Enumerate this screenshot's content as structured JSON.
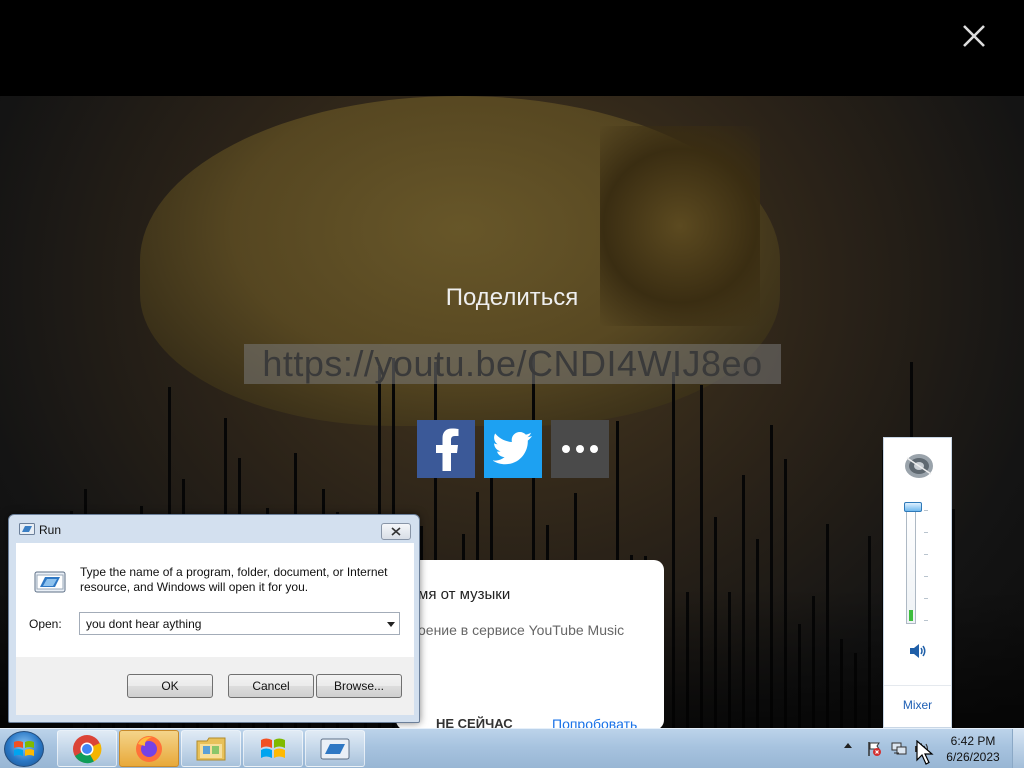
{
  "video": {
    "share_title": "Поделиться",
    "share_url": "https://youtu.be/CNDI4WIJ8eo",
    "share_buttons": [
      {
        "name": "facebook",
        "icon": "facebook-icon",
        "color": "#3b5998"
      },
      {
        "name": "twitter",
        "icon": "twitter-icon",
        "color": "#1da1f2"
      },
      {
        "name": "more",
        "icon": "more-dots-icon",
        "color": "#4a4a4a"
      }
    ]
  },
  "promo": {
    "title": "мя от музыки",
    "subtitle": "оение в сервисе YouTube Music",
    "later": "НЕ СЕЙЧАС",
    "try": "Попробовать"
  },
  "volume": {
    "level": 0.1,
    "mixer_label": "Mixer"
  },
  "run_dialog": {
    "title": "Run",
    "description": "Type the name of a program, folder, document, or Internet resource, and Windows will open it for you.",
    "open_label": "Open:",
    "open_value": "you dont hear aything",
    "ok_label": "OK",
    "cancel_label": "Cancel",
    "browse_label": "Browse..."
  },
  "taskbar": {
    "apps": [
      "chrome",
      "firefox",
      "file-explorer",
      "windows",
      "run"
    ],
    "clock_time": "6:42 PM",
    "clock_date": "6/26/2023"
  },
  "colors": {
    "youtube_link": "#1a73e8",
    "facebook": "#3b5998",
    "twitter": "#1da1f2"
  }
}
